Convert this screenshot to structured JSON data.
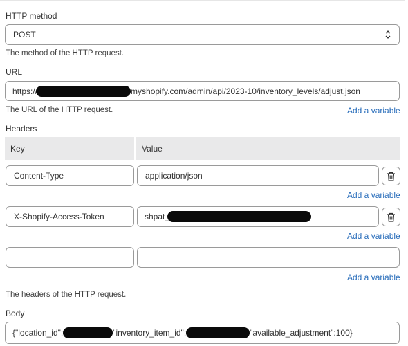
{
  "method": {
    "label": "HTTP method",
    "value": "POST",
    "help": "The method of the HTTP request."
  },
  "url": {
    "label": "URL",
    "prefix": "https://",
    "suffix": "myshopify.com/admin/api/2023-10/inventory_levels/adjust.json",
    "help": "The URL of the HTTP request.",
    "add_variable": "Add a variable"
  },
  "headers": {
    "label": "Headers",
    "col_key": "Key",
    "col_value": "Value",
    "rows": [
      {
        "key": "Content-Type",
        "value": "application/json",
        "add_variable": "Add a variable"
      },
      {
        "key": "X-Shopify-Access-Token",
        "value": "shpat_",
        "add_variable": "Add a variable"
      },
      {
        "key": "",
        "value": "",
        "add_variable": "Add a variable"
      }
    ],
    "help": "The headers of the HTTP request."
  },
  "body": {
    "label": "Body",
    "part1": "{\"location_id\":",
    "part2": "\"inventory_item_id\":",
    "part3": "\"available_adjustment\":100}"
  },
  "icons": {
    "select": "chevron-updown-icon",
    "delete": "trash-icon"
  }
}
